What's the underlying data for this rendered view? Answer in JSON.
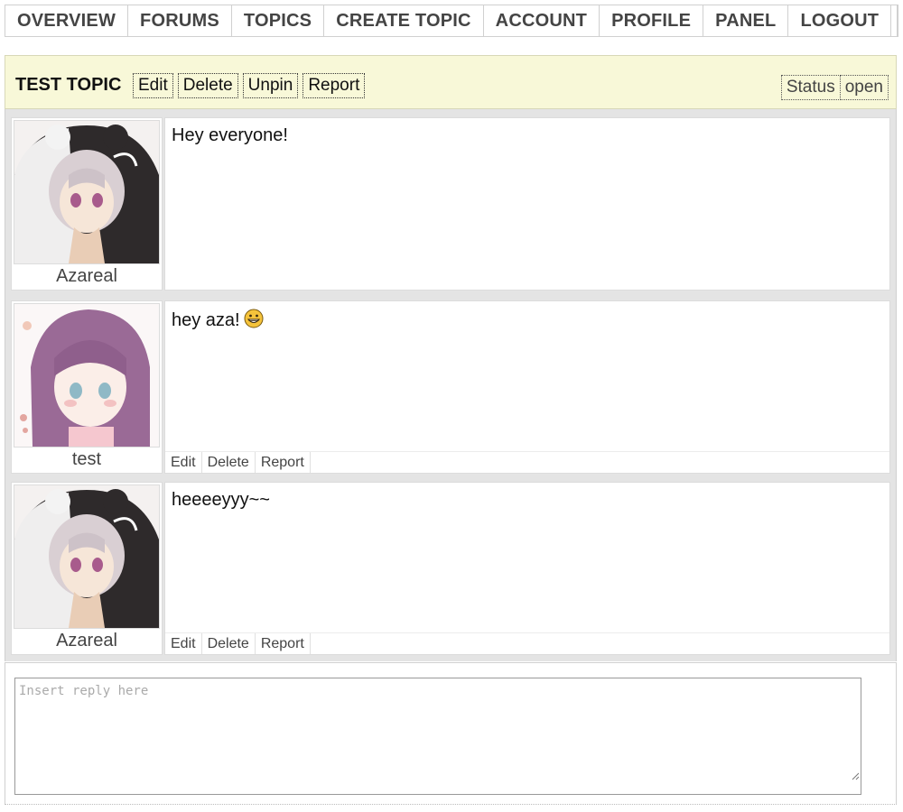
{
  "nav": {
    "items": [
      "OVERVIEW",
      "FORUMS",
      "TOPICS",
      "CREATE TOPIC",
      "ACCOUNT",
      "PROFILE",
      "PANEL",
      "LOGOUT"
    ]
  },
  "topic": {
    "title": "TEST TOPIC",
    "actions": {
      "edit": "Edit",
      "delete": "Delete",
      "unpin": "Unpin",
      "report": "Report"
    },
    "status_label": "Status",
    "status_value": "open"
  },
  "posts": [
    {
      "username": "Azareal",
      "content": "Hey everyone!",
      "avatar": "avatar-azareal",
      "has_actions": false
    },
    {
      "username": "test",
      "content": "hey aza!",
      "emoji": "grinning-face-icon",
      "avatar": "avatar-test",
      "has_actions": true,
      "actions": {
        "edit": "Edit",
        "delete": "Delete",
        "report": "Report"
      }
    },
    {
      "username": "Azareal",
      "content": "heeeeyyy~~",
      "avatar": "avatar-azareal",
      "has_actions": true,
      "actions": {
        "edit": "Edit",
        "delete": "Delete",
        "report": "Report"
      }
    }
  ],
  "reply": {
    "placeholder": "Insert reply here",
    "value": ""
  },
  "colors": {
    "header_bg": "#f8f8d8",
    "posts_bg": "#e4e4e4"
  }
}
